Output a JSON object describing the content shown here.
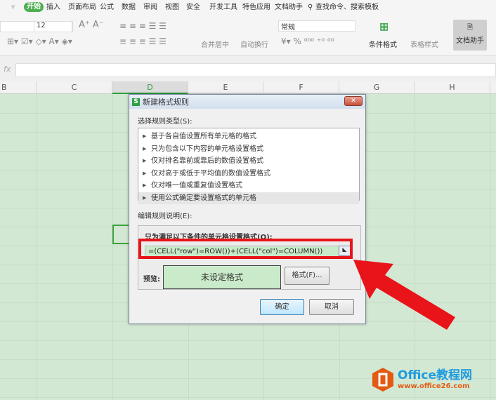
{
  "menu": {
    "items": [
      "开始",
      "插入",
      "页面布局",
      "公式",
      "数据",
      "审阅",
      "视图",
      "安全",
      "开发工具",
      "特色应用",
      "文档助手"
    ],
    "search": "查找命令、搜索模板"
  },
  "toolbar": {
    "font_size": "12",
    "number_format": "常规",
    "merge": "合并居中",
    "wrap": "自动换行",
    "cond_format": "条件格式",
    "table_style": "表格样式",
    "doc_helper": "文档助手"
  },
  "formula_bar": {
    "fx": "fx",
    "value": ""
  },
  "columns": [
    "B",
    "C",
    "D",
    "E",
    "F",
    "G",
    "H"
  ],
  "selected_column": "D",
  "dialog": {
    "title": "新建格式规则",
    "rule_type_label": "选择规则类型(S):",
    "rule_types": [
      "基于各自值设置所有单元格的格式",
      "只为包含以下内容的单元格设置格式",
      "仅对排名靠前或靠后的数值设置格式",
      "仅对高于或低于平均值的数值设置格式",
      "仅对唯一值或重复值设置格式",
      "使用公式确定要设置格式的单元格"
    ],
    "selected_rule": 5,
    "edit_label": "编辑规则说明(E):",
    "formula_label": "只为满足以下条件的单元格设置格式(O):",
    "formula": "=(CELL(\"row\")=ROW())+(CELL(\"col\")=COLUMN())",
    "preview_label": "预览:",
    "preview_text": "未设定格式",
    "format_button": "格式(F)...",
    "ok": "确定",
    "cancel": "取消"
  },
  "watermark": {
    "name": "Office教程网",
    "url": "www.office26.com"
  },
  "colors": {
    "accent": "#4caf50",
    "highlight": "#e8141a",
    "grid": "#d3e8d3"
  }
}
